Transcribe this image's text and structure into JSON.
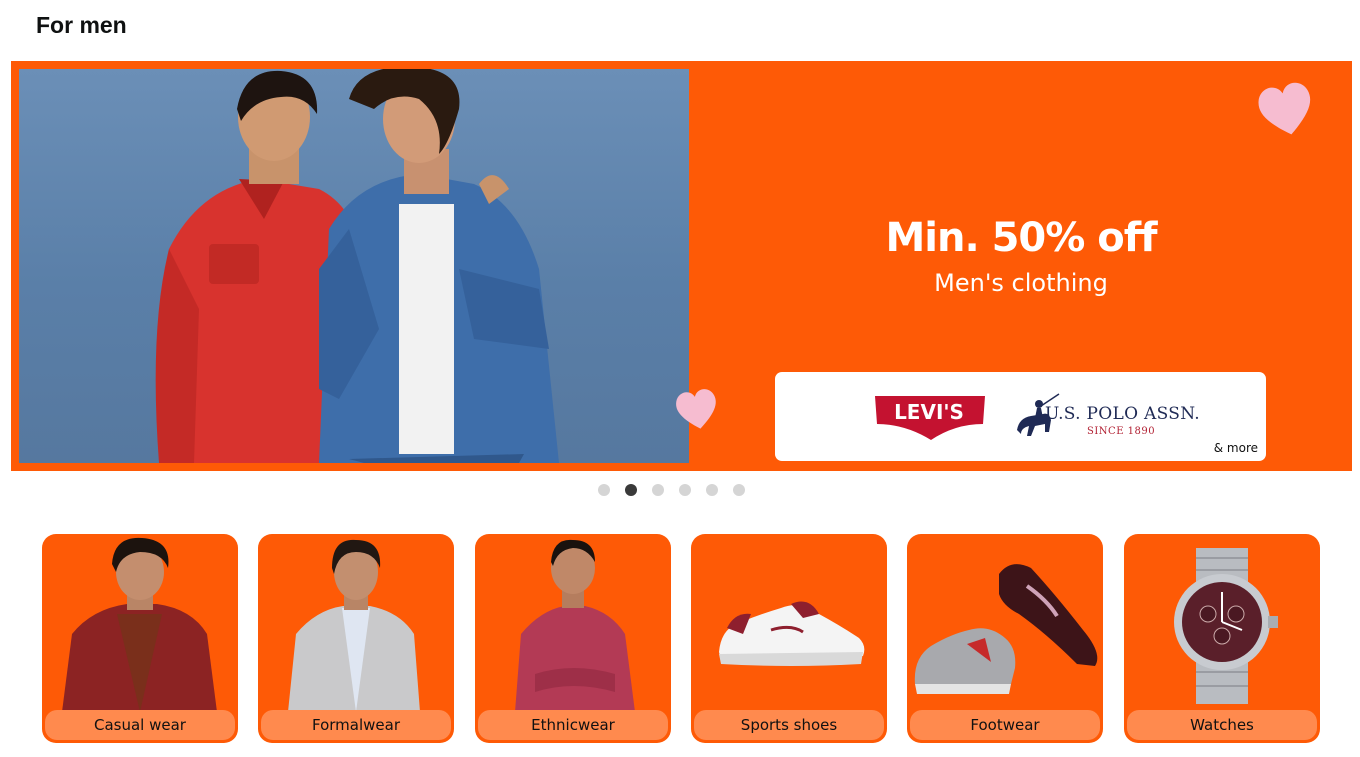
{
  "section": {
    "title": "For men"
  },
  "banner": {
    "headline": "Min. 50% off",
    "subheadline": "Men's clothing",
    "brands": {
      "levis": "LEVI'S",
      "polo_name": "U.S. POLO ASSN.",
      "polo_since": "SINCE 1890",
      "more": "& more"
    },
    "accent_color": "#fe5a06"
  },
  "carousel": {
    "total_slides": 6,
    "active_slide": 2
  },
  "categories": [
    {
      "label": "Casual wear"
    },
    {
      "label": "Formalwear"
    },
    {
      "label": "Ethnicwear"
    },
    {
      "label": "Sports shoes"
    },
    {
      "label": "Footwear"
    },
    {
      "label": "Watches"
    }
  ]
}
